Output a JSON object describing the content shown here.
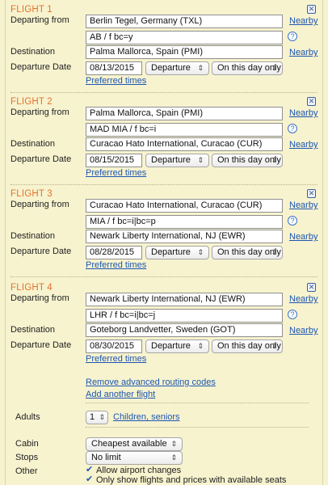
{
  "flights": [
    {
      "title": "FLIGHT 1",
      "departing_label": "Departing from",
      "departing_value": "Berlin Tegel, Germany (TXL)",
      "routing_value": "AB / f bc=y",
      "destination_label": "Destination",
      "destination_value": "Palma Mallorca, Spain (PMI)",
      "date_label": "Departure Date",
      "date_value": "08/13/2015",
      "mode_value": "Departure",
      "flex_value": "On this day only",
      "preferred_times": "Preferred times",
      "nearby1": "Nearby",
      "nearby2": "Nearby"
    },
    {
      "title": "FLIGHT 2",
      "departing_label": "Departing from",
      "departing_value": "Palma Mallorca, Spain (PMI)",
      "routing_value": "MAD MIA / f bc=i",
      "destination_label": "Destination",
      "destination_value": "Curacao Hato International, Curacao (CUR)",
      "date_label": "Departure Date",
      "date_value": "08/15/2015",
      "mode_value": "Departure",
      "flex_value": "On this day only",
      "preferred_times": "Preferred times",
      "nearby1": "Nearby",
      "nearby2": "Nearby"
    },
    {
      "title": "FLIGHT 3",
      "departing_label": "Departing from",
      "departing_value": "Curacao Hato International, Curacao (CUR)",
      "routing_value": "MIA / f bc=i|bc=p",
      "destination_label": "Destination",
      "destination_value": "Newark Liberty International, NJ (EWR)",
      "date_label": "Departure Date",
      "date_value": "08/28/2015",
      "mode_value": "Departure",
      "flex_value": "On this day only",
      "preferred_times": "Preferred times",
      "nearby1": "Nearby",
      "nearby2": "Nearby"
    },
    {
      "title": "FLIGHT 4",
      "departing_label": "Departing from",
      "departing_value": "Newark Liberty International, NJ (EWR)",
      "routing_value": "LHR / f bc=i|bc=j",
      "destination_label": "Destination",
      "destination_value": "Goteborg Landvetter, Sweden (GOT)",
      "date_label": "Departure Date",
      "date_value": "08/30/2015",
      "mode_value": "Departure",
      "flex_value": "On this day only",
      "preferred_times": "Preferred times",
      "nearby1": "Nearby",
      "nearby2": "Nearby"
    }
  ],
  "icons": {
    "close": "close-x-icon",
    "help": "question-mark-icon",
    "dropdown": "up-down-arrows-icon",
    "check": "checkmark-icon"
  },
  "links": {
    "remove_routing": "Remove advanced routing codes",
    "add_flight": "Add another flight",
    "children_seniors": "Children, seniors"
  },
  "passengers": {
    "adults_label": "Adults",
    "adults_value": "1"
  },
  "options": {
    "cabin_label": "Cabin",
    "cabin_value": "Cheapest available",
    "stops_label": "Stops",
    "stops_value": "No limit",
    "other_label": "Other",
    "allow_airport_changes": "Allow airport changes",
    "only_available_seats": "Only show flights and prices with available seats"
  },
  "colors": {
    "background": "#f7f3cf",
    "flight_title": "#e5712e",
    "link": "#1d56b3"
  }
}
